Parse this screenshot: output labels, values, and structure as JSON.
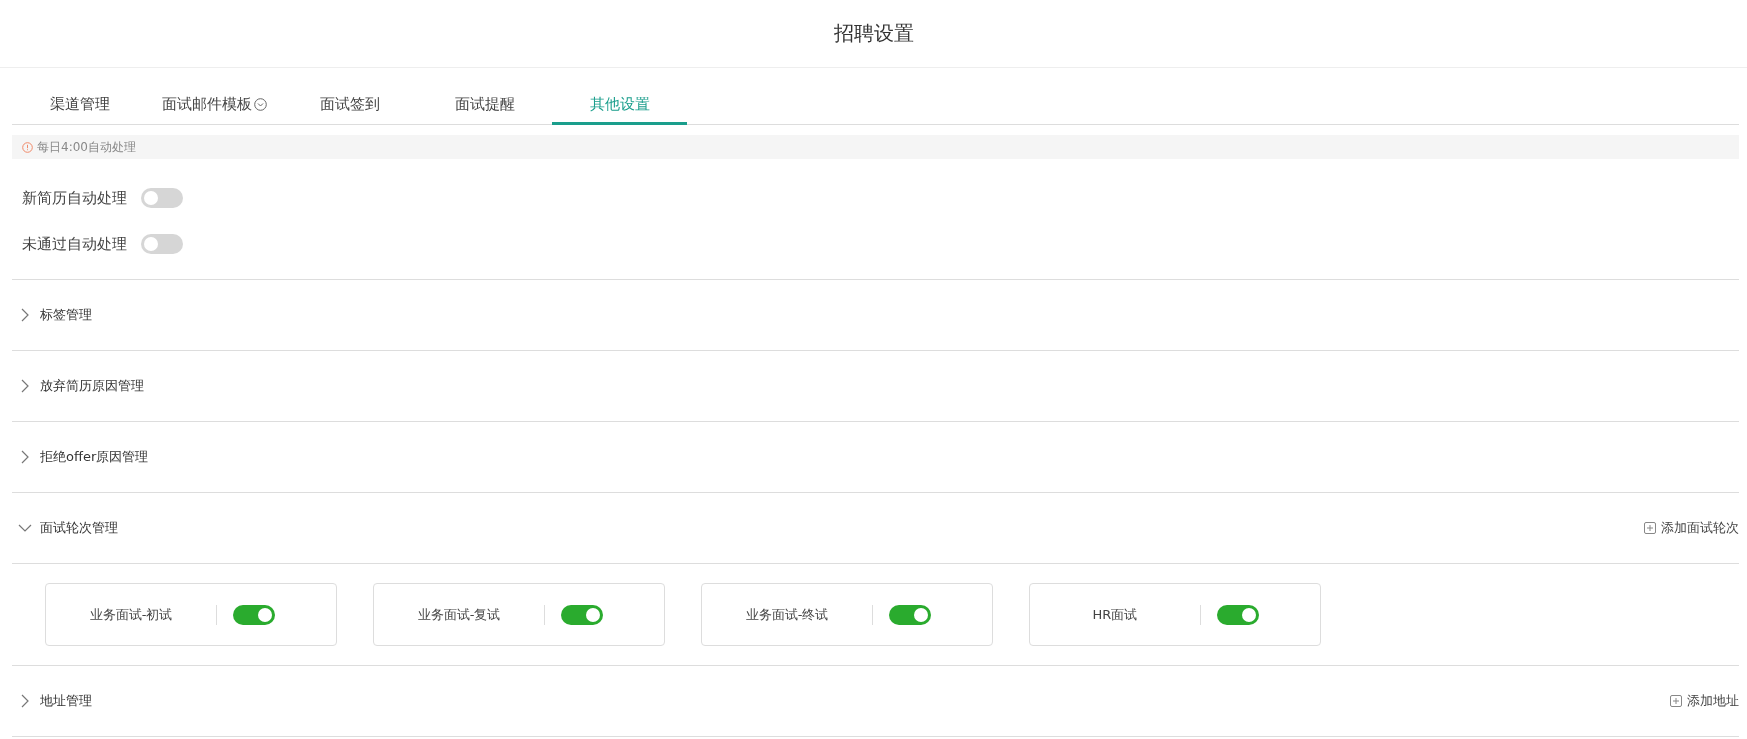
{
  "title": "招聘设置",
  "tabs": [
    {
      "label": "渠道管理",
      "selected": false,
      "dropdown": false
    },
    {
      "label": "面试邮件模板",
      "selected": false,
      "dropdown": true
    },
    {
      "label": "面试签到",
      "selected": false,
      "dropdown": false
    },
    {
      "label": "面试提醒",
      "selected": false,
      "dropdown": false
    },
    {
      "label": "其他设置",
      "selected": true,
      "dropdown": false
    }
  ],
  "notice": "每日4:00自动处理",
  "auto_settings": [
    {
      "label": "新简历自动处理",
      "on": false
    },
    {
      "label": "未通过自动处理",
      "on": false
    }
  ],
  "sections": [
    {
      "title": "标签管理",
      "expanded": false
    },
    {
      "title": "放弃简历原因管理",
      "expanded": false
    },
    {
      "title": "拒绝offer原因管理",
      "expanded": false
    },
    {
      "title": "面试轮次管理",
      "expanded": true,
      "action": "添加面试轮次",
      "rounds": [
        {
          "label": "业务面试-初试",
          "on": true
        },
        {
          "label": "业务面试-复试",
          "on": true
        },
        {
          "label": "业务面试-终试",
          "on": true
        },
        {
          "label": "HR面试",
          "on": true
        }
      ]
    },
    {
      "title": "地址管理",
      "expanded": false,
      "action": "添加地址"
    }
  ]
}
